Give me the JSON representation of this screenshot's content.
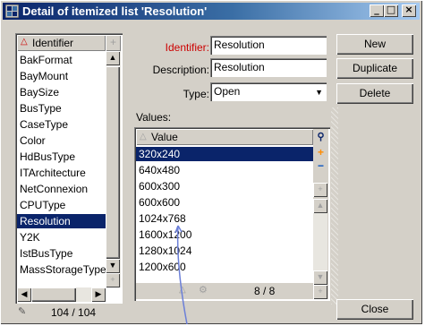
{
  "window": {
    "title": "Detail of itemized list 'Resolution'"
  },
  "titlebar_buttons": {
    "minimize": "_",
    "maximize": "□",
    "close": "×"
  },
  "left_list": {
    "header": "Identifier",
    "items": [
      "BakFormat",
      "BayMount",
      "BaySize",
      "BusType",
      "CaseType",
      "Color",
      "HdBusType",
      "ITArchitecture",
      "NetConnexion",
      "CPUType",
      "Resolution",
      "Y2K",
      "IstBusType",
      "MassStorageType"
    ],
    "selected_index": 10,
    "counter": "104 / 104"
  },
  "form": {
    "identifier_label": "Identifier:",
    "identifier_value": "Resolution",
    "description_label": "Description:",
    "description_value": "Resolution",
    "type_label": "Type:",
    "type_value": "Open",
    "values_label": "Values:"
  },
  "values_list": {
    "header": "Value",
    "items": [
      "320x240",
      "640x480",
      "600x300",
      "600x600",
      "1024x768",
      "1600x1200",
      "1280x1024",
      "1200x600"
    ],
    "selected_index": 0,
    "counter": "8 / 8"
  },
  "buttons": {
    "new": "New",
    "duplicate": "Duplicate",
    "delete": "Delete",
    "close": "Close"
  },
  "colors": {
    "selection": "#0a246a",
    "identifier_label": "#cc0000",
    "annotation_arrow": "#6b7fd8"
  }
}
